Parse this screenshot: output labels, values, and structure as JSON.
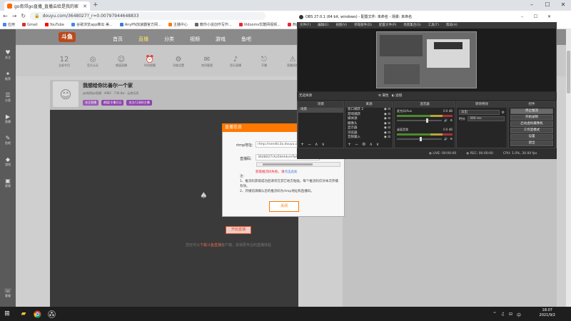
{
  "browser": {
    "tab_title": "go南郊go直播_直播云给是我的家",
    "url": "douyu.com/3648027?_r=0.00797944648833",
    "bookmarks": [
      {
        "label": "应用",
        "color": "#4285f4"
      },
      {
        "label": "Gmail",
        "color": "#d93025"
      },
      {
        "label": "YouTube",
        "color": "#ff0000"
      },
      {
        "label": "谷歌浏览app推出 美...",
        "color": "#4285f4"
      },
      {
        "label": "AnyPN加速器官方网...",
        "color": "#3a7ad8"
      },
      {
        "label": "主播中心",
        "color": "#ff7800"
      },
      {
        "label": "教你小说创作写作...",
        "color": "#666"
      },
      {
        "label": "Vidooms优酷网视频...",
        "color": "#e23"
      },
      {
        "label": "西瓜视频手机版...",
        "color": "#e23"
      }
    ]
  },
  "douyu": {
    "logo": "斗鱼",
    "nav": [
      "首页",
      "直播",
      "分类",
      "视频",
      "游戏",
      "鱼吧"
    ],
    "nav_active": 1,
    "categories": [
      {
        "icon": "12",
        "label": "全部节目"
      },
      {
        "icon": "◎",
        "label": "官方认证"
      },
      {
        "icon": "☺",
        "label": "颜值直播"
      },
      {
        "icon": "⏰",
        "label": "时间提醒"
      },
      {
        "icon": "⚙",
        "label": "功能设置"
      },
      {
        "icon": "✉",
        "label": "房间管理"
      },
      {
        "icon": "♪",
        "label": "音乐直播"
      },
      {
        "icon": "⎋",
        "label": "开播"
      },
      {
        "icon": "⚠",
        "label": "直播须知"
      },
      {
        "icon": "⊕",
        "label": "直播分享"
      },
      {
        "icon": "✪",
        "label": "主播"
      }
    ],
    "left_items": [
      "关注",
      "推荐",
      "分类",
      "直播",
      "鱼吧",
      "游戏",
      "视频"
    ],
    "left_bottom": "客服",
    "room_title": "我想给你比善尔一个家",
    "room_sub": "go南郊go直播 · 4982 · 736.8w · 云南玩家",
    "room_tags": [
      {
        "label": "关注直播",
        "color": "#9b59b6"
      },
      {
        "label": "颜值/主播日记",
        "color": "#8e44ad"
      },
      {
        "label": "关注/订阅的主播",
        "color": "#8e44ad"
      }
    ],
    "start_button": "开始直播",
    "bottom_hint_pre": "您还可以",
    "bottom_hint_link": "下载斗鱼直播",
    "bottom_hint_post": "客户端，获得更专业的直播体验"
  },
  "dialog": {
    "title": "直播信息",
    "close": "✕",
    "rtmp_label": "rtmp地址:",
    "rtmp_value": "rtmp://sendtc3a.douyu.com/live",
    "key_label": "直播码:",
    "key_value": "3648027rXo5feHdvmTw9eY75u-",
    "copy": "复制",
    "error_text": "获取推流码失败，请",
    "error_link": "点击此处",
    "notes": [
      "注:",
      "1、推流码获取成功后请勿在其它地方粘贴，每个推流码仅对本次开播有效。",
      "2、开播前请确认您的推流码为rtmp地址和直播码。"
    ],
    "ok": "关闭"
  },
  "obs": {
    "title": "OBS 27.0.1 (64 bit, windows) - 配置文件: 未命名 - 场景: 未命名",
    "menu": [
      "文件(F)",
      "编辑(E)",
      "视图(V)",
      "停靠部件(D)",
      "配置文件(P)",
      "场景集合(S)",
      "工具(T)",
      "帮助(H)"
    ],
    "source_bar_left": "无选择源",
    "source_bar_props": "⚙ 属性",
    "source_bar_filters": "◐ 滤镜",
    "scenes_title": "场景",
    "scenes": [
      "场景"
    ],
    "sources_title": "来源",
    "sources": [
      "窗口捕获 2",
      "游戏捕获",
      "媒体源",
      "摄像头",
      "显示器",
      "浏览器",
      "音频输入"
    ],
    "mixer_title": "混音器",
    "mixer_tracks": [
      {
        "name": "麦克风/Aux",
        "db": "0.0 dB",
        "level": 0.65
      },
      {
        "name": "桌面音频",
        "db": "0.0 dB",
        "level": 0.5
      }
    ],
    "transitions_title": "转场特效",
    "transition_value": "淡出",
    "duration_label": "时长",
    "duration_value": "300 ms",
    "controls_title": "控件",
    "controls": [
      "停止推流",
      "开始录制",
      "启动虚拟摄像机",
      "工作室模式",
      "设置",
      "退出"
    ],
    "status": [
      "LIVE: 00:00:00",
      "REC: 00:00:00",
      "CPU: 1.0%, 30.00 fps"
    ],
    "status_icons": [
      "●",
      "●"
    ]
  },
  "taskbar": {
    "start_icon": "⊞",
    "apps": [
      "folder-icon",
      "chrome-icon",
      "obs-icon"
    ],
    "time": "18:07",
    "date": "2021/9/2",
    "tray": [
      "^",
      "♫",
      "⊟",
      "中"
    ]
  }
}
